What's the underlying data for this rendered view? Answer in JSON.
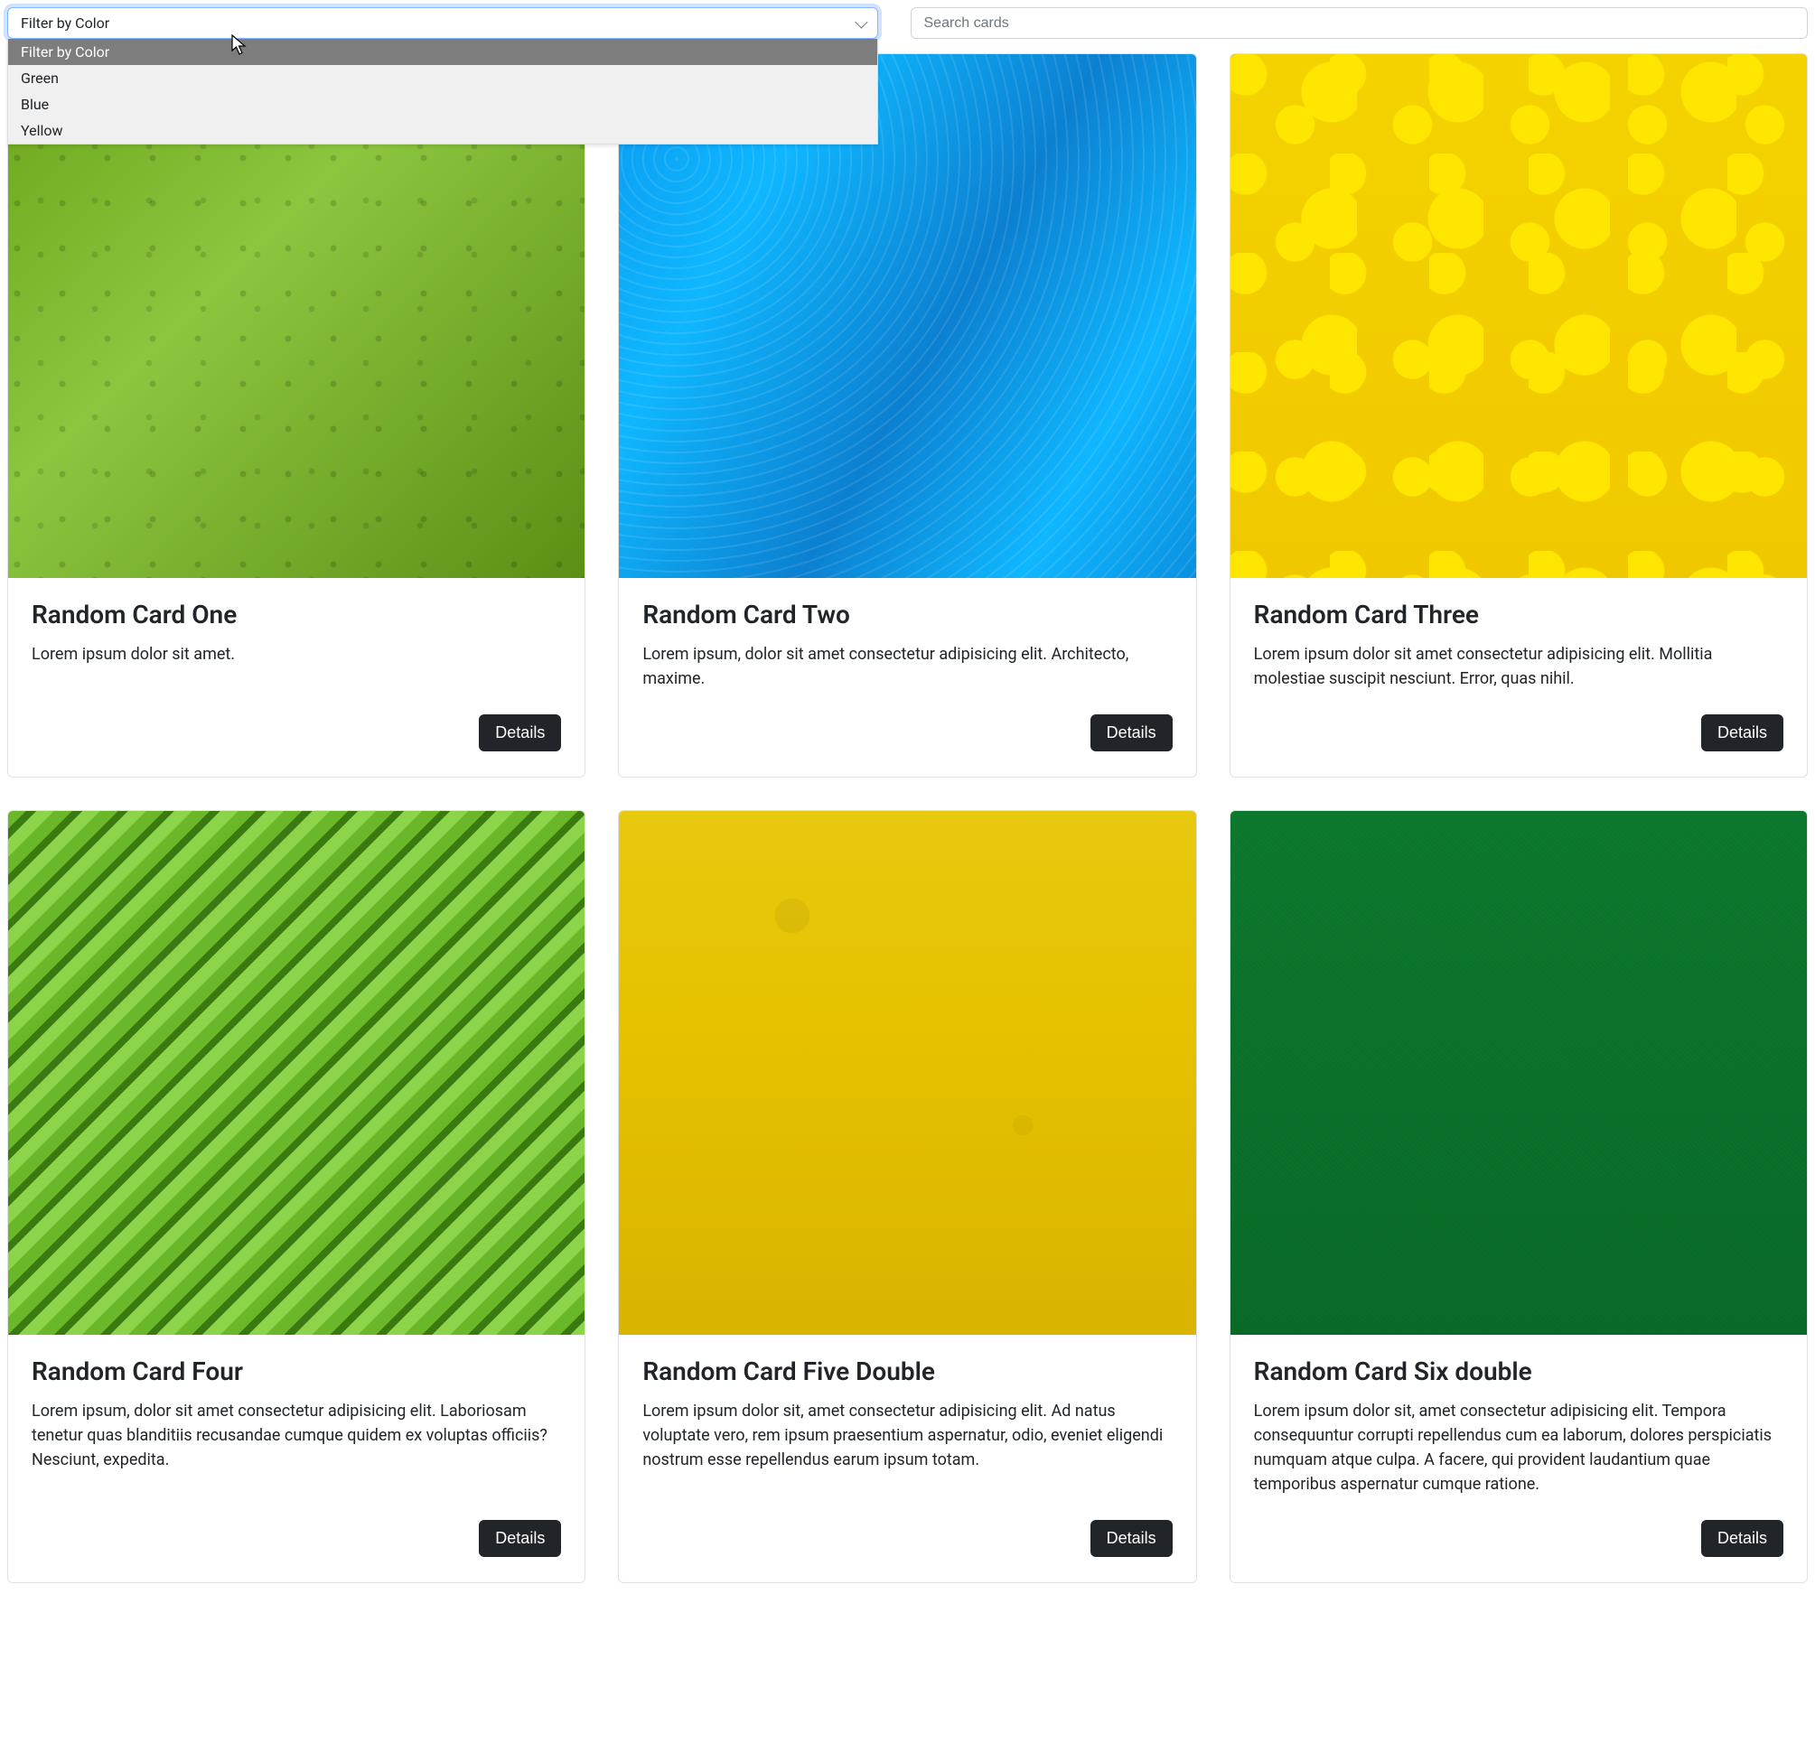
{
  "filter": {
    "placeholder": "Filter by Color",
    "selected": "Filter by Color",
    "options": [
      "Filter by Color",
      "Green",
      "Blue",
      "Yellow"
    ]
  },
  "search": {
    "placeholder": "Search cards"
  },
  "cards": [
    {
      "title": "Random Card One",
      "text": "Lorem ipsum dolor sit amet.",
      "button": "Details",
      "img": "img-green-lego"
    },
    {
      "title": "Random Card Two",
      "text": "Lorem ipsum, dolor sit amet consectetur adipisicing elit. Architecto, maxime.",
      "button": "Details",
      "img": "img-blue-paint"
    },
    {
      "title": "Random Card Three",
      "text": "Lorem ipsum dolor sit amet consectetur adipisicing elit. Mollitia molestiae suscipit nesciunt. Error, quas nihil.",
      "button": "Details",
      "img": "img-yellow-balls"
    },
    {
      "title": "Random Card Four",
      "text": "Lorem ipsum, dolor sit amet consectetur adipisicing elit. Laboriosam tenetur quas blanditiis recusandae cumque quidem ex voluptas officiis? Nesciunt, expedita.",
      "button": "Details",
      "img": "img-green-leaves"
    },
    {
      "title": "Random Card Five Double",
      "text": "Lorem ipsum dolor sit, amet consectetur adipisicing elit. Ad natus voluptate vero, rem ipsum praesentium aspernatur, odio, eveniet eligendi nostrum esse repellendus earum ipsum totam.",
      "button": "Details",
      "img": "img-yellow-wall"
    },
    {
      "title": "Random Card Six double",
      "text": "Lorem ipsum dolor sit, amet consectetur adipisicing elit. Tempora consequuntur corrupti repellendus cum ea laborum, dolores perspiciatis numquam atque culpa. A facere, qui provident laudantium quae temporibus aspernatur cumque ratione.",
      "button": "Details",
      "img": "img-green-felt"
    }
  ]
}
